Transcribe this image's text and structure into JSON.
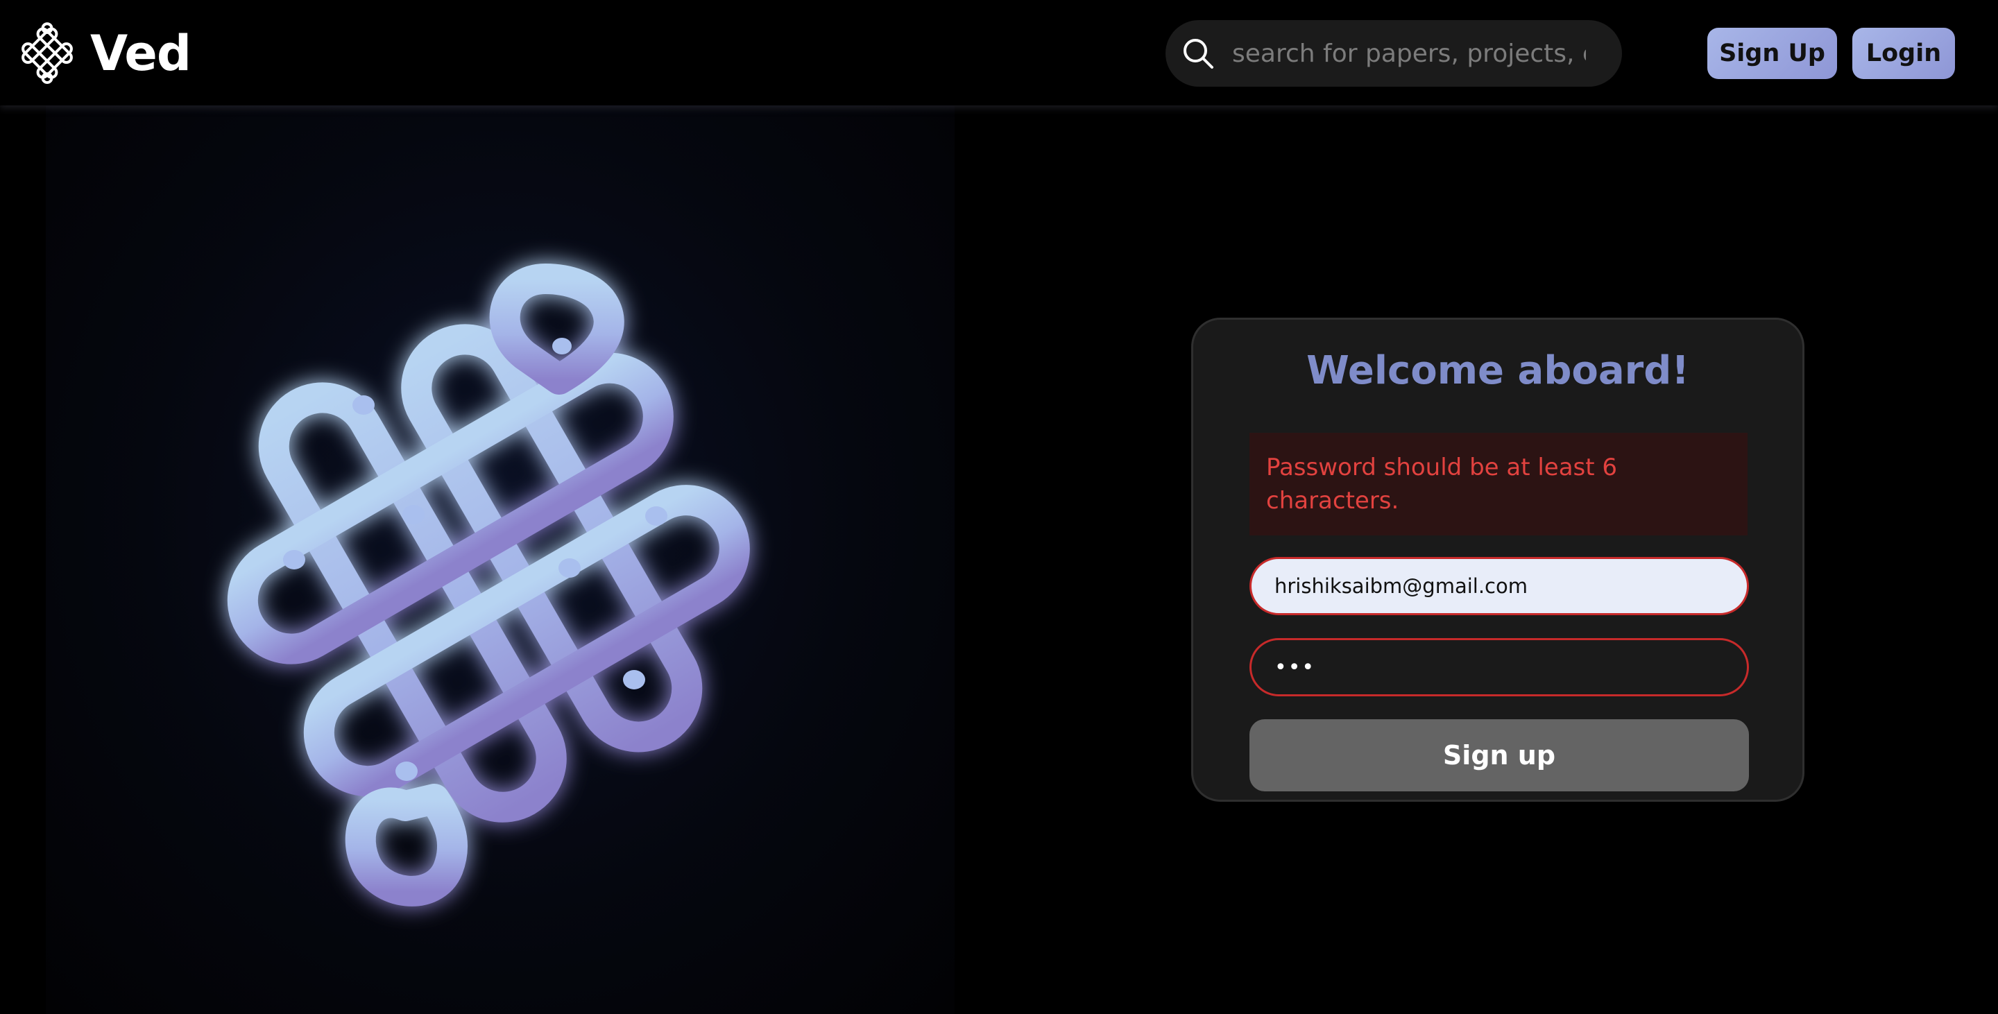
{
  "header": {
    "brand_name": "Ved",
    "search_placeholder": "search for papers, projects, etc",
    "signup_label": "Sign Up",
    "login_label": "Login"
  },
  "signup_card": {
    "title": "Welcome aboard!",
    "error_message": "Password should be at least 6 characters.",
    "email_value": "hrishiksaibm@gmail.com",
    "password_value": "abc",
    "submit_label": "Sign up"
  },
  "colors": {
    "accent_title": "#7f8cc9",
    "button_gradient_start": "#a8b6e8",
    "button_gradient_end": "#8e96d6",
    "error_text": "#e2423f",
    "error_background": "#2c1313",
    "field_error_border": "#c72a2a",
    "submit_disabled": "#646464"
  },
  "icons": {
    "brand": "knot-logo-icon",
    "search": "search-icon",
    "hero": "endless-knot-icon"
  }
}
